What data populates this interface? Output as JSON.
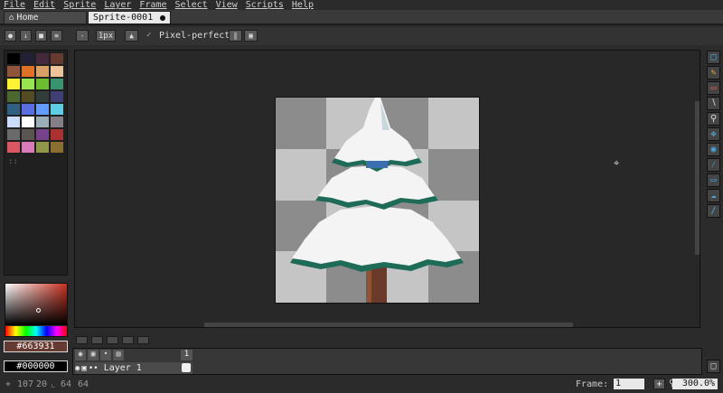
{
  "menu": [
    "File",
    "Edit",
    "Sprite",
    "Layer",
    "Frame",
    "Select",
    "View",
    "Scripts",
    "Help"
  ],
  "tabs": [
    {
      "label": "Home",
      "icon": "home-icon"
    },
    {
      "label": "Sprite-0001",
      "icon": "modified-dot-icon"
    }
  ],
  "context_bar": {
    "brush_size": "1px",
    "pixel_perfect_label": "Pixel-perfect",
    "pixel_perfect_checked": true
  },
  "colors": {
    "foreground_hex": "#663931",
    "background_hex": "#000000",
    "foreground": "#663931",
    "background": "#000000",
    "accent": "#4aa9e0"
  },
  "palette": [
    "#000000",
    "#222034",
    "#45283c",
    "#663931",
    "#8f563b",
    "#df7126",
    "#d9a066",
    "#eec39a",
    "#fbf236",
    "#99e550",
    "#6abe30",
    "#37946e",
    "#4b692f",
    "#524b24",
    "#323c39",
    "#3f3f74",
    "#306082",
    "#5b6ee1",
    "#639bff",
    "#5fcde4",
    "#cbdbfc",
    "#ffffff",
    "#9badb7",
    "#847e87",
    "#696a6a",
    "#595652",
    "#76428a",
    "#ac3232",
    "#d95763",
    "#d77bba",
    "#8f974a",
    "#8a6f30"
  ],
  "layers": [
    {
      "name": "Layer 1",
      "visible": true,
      "locked": false
    }
  ],
  "frames": [
    "1"
  ],
  "status": {
    "cursor_x": "107",
    "cursor_y": "20",
    "size_w": "64",
    "size_h": "64",
    "frame_label": "Frame:",
    "frame_value": "1",
    "zoom": "300.0%"
  },
  "tools": [
    "marquee-icon",
    "pencil-icon",
    "eraser-icon",
    "eyedropper-icon",
    "zoom-icon",
    "move-icon",
    "bucket-icon",
    "line-icon",
    "rectangle-icon",
    "blur-icon",
    "ink-icon"
  ]
}
